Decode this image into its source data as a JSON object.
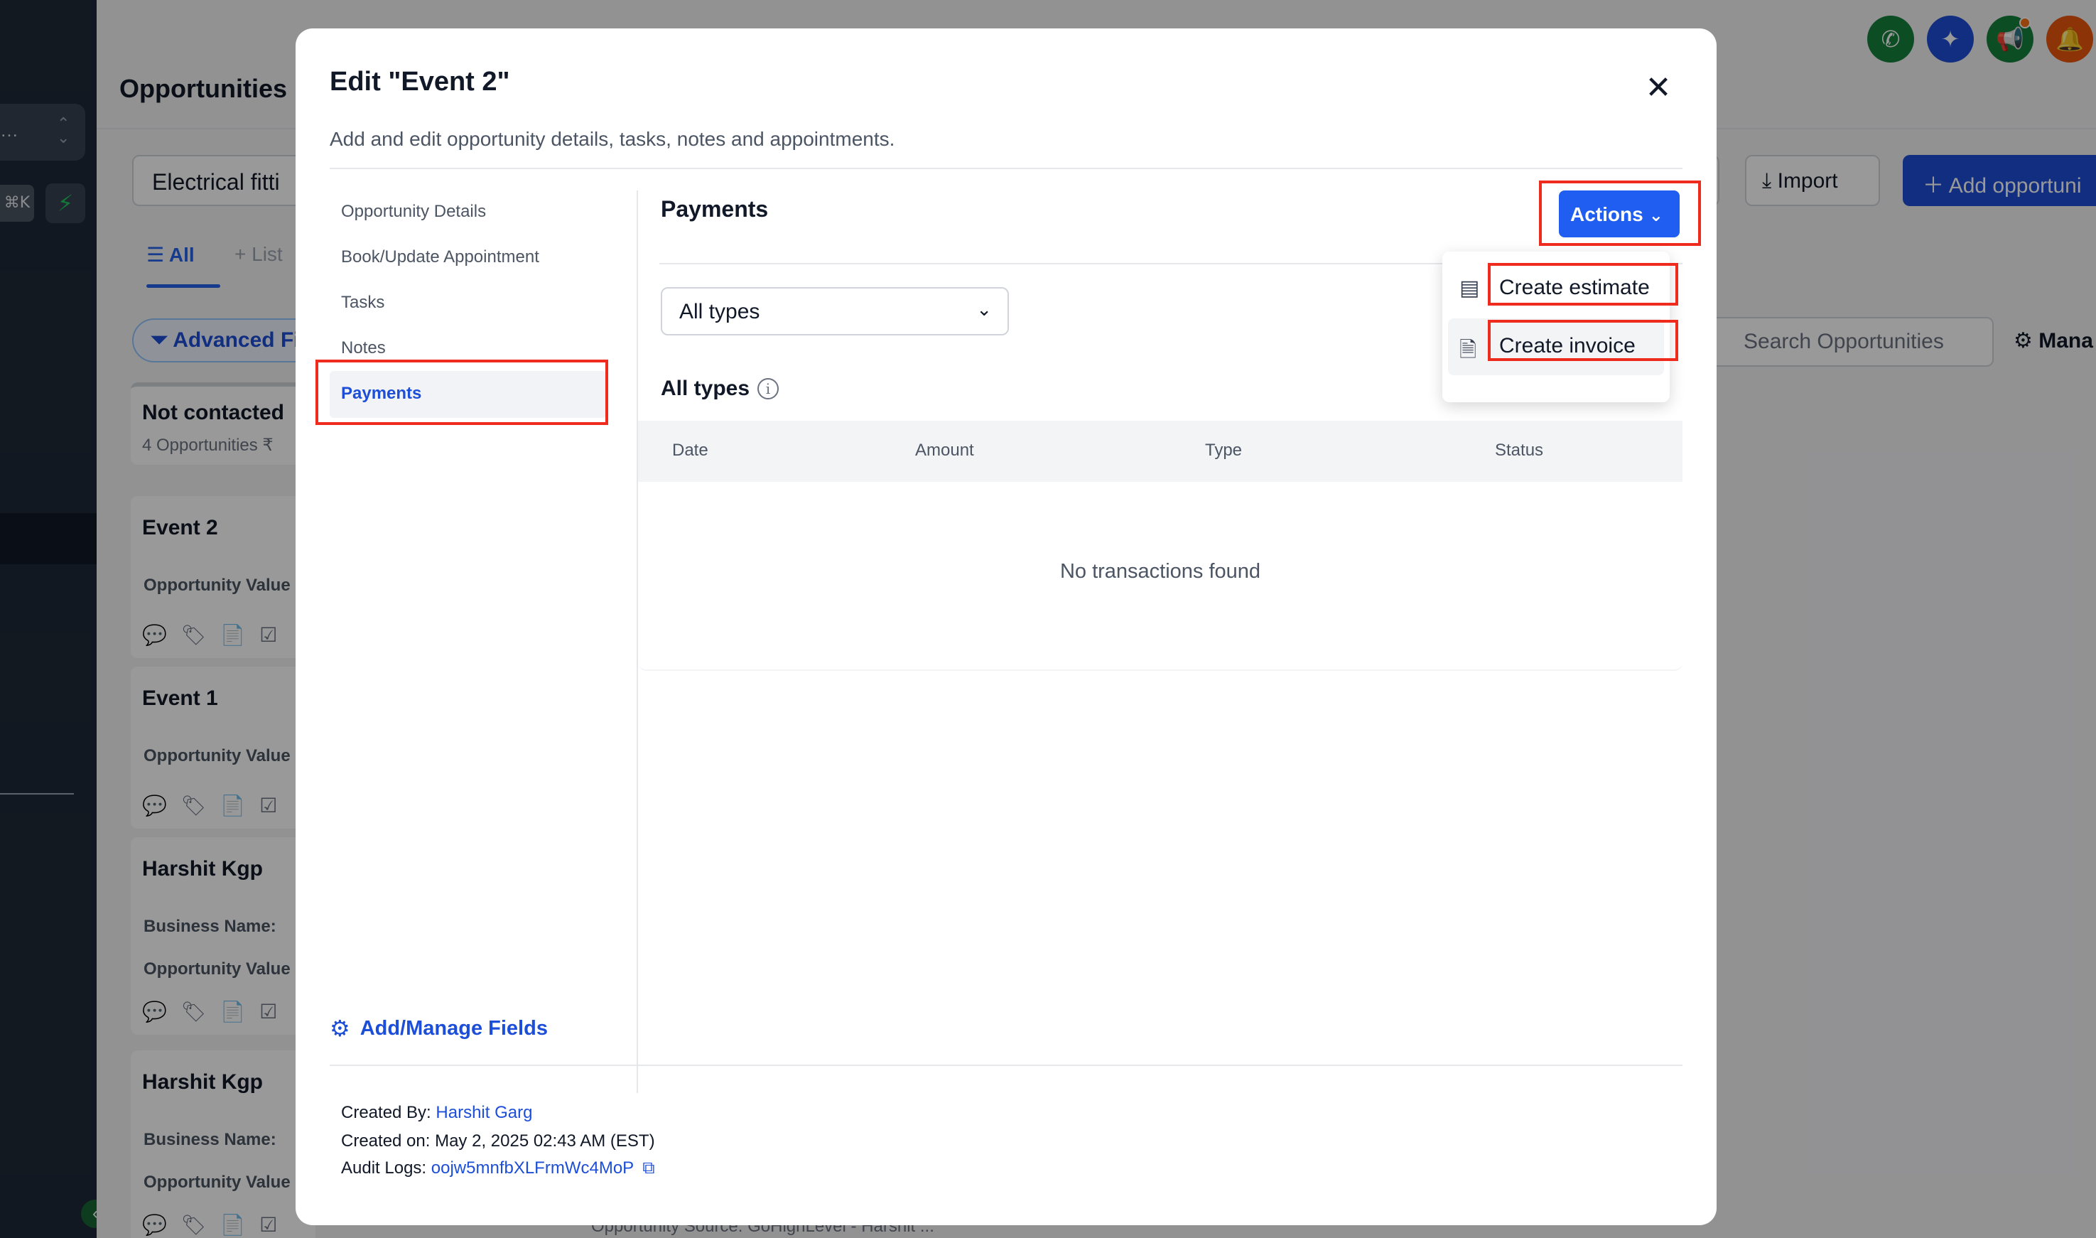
{
  "background": {
    "page_title": "Opportunities",
    "pipeline_value": "Electrical fitti",
    "tabs": {
      "all": "All",
      "list": "List"
    },
    "advanced_filters": "Advanced Fi",
    "column": {
      "title": "Not contacted",
      "subtitle": "4 Opportunities ₹"
    },
    "cards": [
      {
        "title": "Event 2",
        "fields": [
          "Opportunity Value"
        ]
      },
      {
        "title": "Event 1",
        "fields": [
          "Opportunity Value"
        ]
      },
      {
        "title": "Harshit Kgp",
        "fields": [
          "Business Name:",
          "Opportunity Value"
        ]
      },
      {
        "title": "Harshit Kgp",
        "fields": [
          "Business Name:",
          "Opportunity Value"
        ]
      }
    ],
    "import_label": "Import",
    "add_label": "Add opportuni",
    "search_placeholder": "Search Opportunities",
    "manage_label": "Mana",
    "bottom_source": "Opportunity Source:  GoHighLevel - Harshit ..."
  },
  "modal": {
    "title": "Edit \"Event 2\"",
    "subtitle": "Add and edit opportunity details, tasks, notes and appointments.",
    "nav": [
      "Opportunity Details",
      "Book/Update Appointment",
      "Tasks",
      "Notes",
      "Payments"
    ],
    "active_nav": "Payments",
    "manage_fields": "Add/Manage Fields",
    "payments": {
      "title": "Payments",
      "actions_label": "Actions",
      "type_filter": "All types",
      "section_label": "All types",
      "columns": [
        "Date",
        "Amount",
        "Type",
        "Status"
      ],
      "empty_text": "No transactions found"
    },
    "actions_menu": [
      "Create estimate",
      "Create invoice"
    ],
    "footer": {
      "created_by_label": "Created By:",
      "created_by": "Harshit Garg",
      "created_on": "Created on: May 2, 2025 02:43 AM (EST)",
      "audit_label": "Audit Logs:",
      "audit_id": "oojw5mnfbXLFrmWc4MoP"
    }
  },
  "colors": {
    "primary": "#1f5ef0",
    "link": "#1d4ed8",
    "highlight": "#ef2b1e",
    "phone_btn": "#15803d",
    "ai_btn": "#1d4ed8",
    "announce_btn": "#15803d",
    "bell_btn": "#ea580c"
  },
  "icons": [
    "phone-icon",
    "sparkle-icon",
    "megaphone-icon",
    "bell-icon",
    "close-icon",
    "gear-icon",
    "info-icon",
    "chevron-down-icon",
    "estimate-icon",
    "invoice-icon",
    "copy-icon"
  ]
}
